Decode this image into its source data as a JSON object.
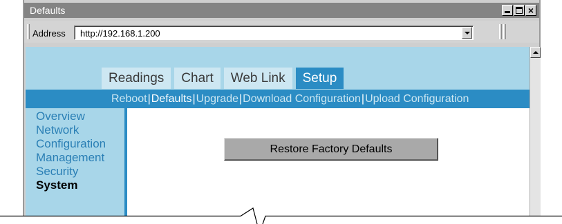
{
  "window": {
    "title": "Defaults",
    "buttons": [
      "minimize",
      "maximize",
      "close"
    ],
    "close_glyph": "×"
  },
  "address_bar": {
    "label": "Address",
    "url": "http://192.168.1.200"
  },
  "tabs": [
    {
      "label": "Readings",
      "active": false
    },
    {
      "label": "Chart",
      "active": false
    },
    {
      "label": "Web Link",
      "active": false
    },
    {
      "label": "Setup",
      "active": true
    }
  ],
  "subnav": {
    "separator": "|",
    "items": [
      {
        "label": "Reboot",
        "current": false
      },
      {
        "label": "Defaults",
        "current": true
      },
      {
        "label": "Upgrade",
        "current": false
      },
      {
        "label": "Download Configuration",
        "current": false
      },
      {
        "label": "Upload Configuration",
        "current": false
      }
    ]
  },
  "sidebar": {
    "items": [
      {
        "label": "Overview",
        "current": false
      },
      {
        "label": "Network",
        "current": false
      },
      {
        "label": "Configuration",
        "current": false
      },
      {
        "label": "Management",
        "current": false
      },
      {
        "label": "Security",
        "current": false
      },
      {
        "label": "System",
        "current": true
      }
    ]
  },
  "main": {
    "restore_button_label": "Restore Factory Defaults"
  },
  "colors": {
    "header_light_blue": "#a8d6e9",
    "accent_blue": "#2b8cc4",
    "link_blue": "#2a7fb5",
    "title_bar_gray": "#848484"
  }
}
